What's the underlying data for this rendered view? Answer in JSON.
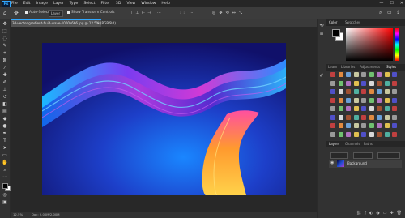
{
  "app": {
    "logo_text": "Ps"
  },
  "menubar": {
    "items": [
      "File",
      "Edit",
      "Image",
      "Layer",
      "Type",
      "Select",
      "Filter",
      "3D",
      "View",
      "Window",
      "Help"
    ],
    "window_controls": [
      "—",
      "☐",
      "✕"
    ]
  },
  "options_bar": {
    "auto_select_label": "Auto-Select:",
    "auto_select_value": "Layer",
    "show_transform_label": "Show Transform Controls"
  },
  "document": {
    "tab_title": "3d-vector-gradient-fluid-wave-1000x666.jpg @ 12.5% (RGB/8#)",
    "close_glyph": "×",
    "status_zoom": "12.5%",
    "status_doc": "Doc: 2.00M/2.00M"
  },
  "panels": {
    "color_tabs": [
      "Color",
      "Swatches"
    ],
    "library_tabs": [
      "Learn",
      "Libraries",
      "Adjustments",
      "Styles"
    ],
    "layers_tabs": [
      "Layers",
      "Channels",
      "Paths"
    ],
    "layer_name": "Background"
  },
  "colors": {
    "accent": "#31a8ff",
    "foreground": "#000000",
    "background": "#ffffff"
  }
}
